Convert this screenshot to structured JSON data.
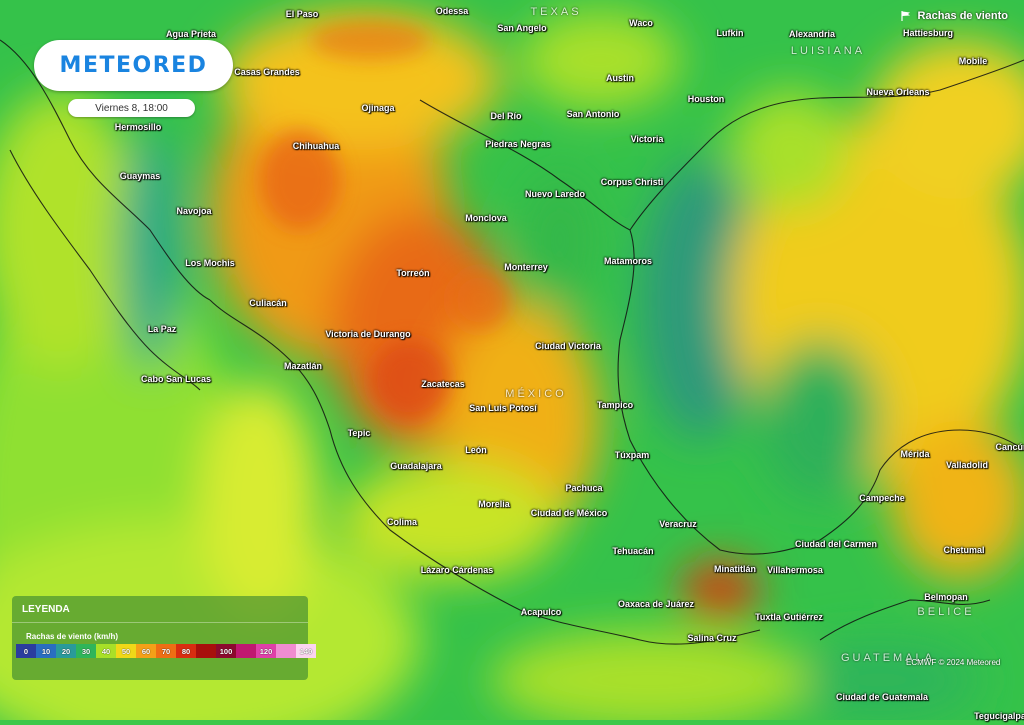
{
  "brand": {
    "logo_text": "METEORED"
  },
  "forecast": {
    "datetime": "Viernes 8, 18:00"
  },
  "layer": {
    "label": "Rachas de viento",
    "icon": "flag-icon"
  },
  "legend": {
    "title": "LEYENDA",
    "units_label": "Rachas de viento (km/h)",
    "scale": [
      {
        "label": "0",
        "color": "#2b3d9e"
      },
      {
        "label": "10",
        "color": "#2a6ec0"
      },
      {
        "label": "20",
        "color": "#2a9a9a"
      },
      {
        "label": "30",
        "color": "#2fb55a"
      },
      {
        "label": "40",
        "color": "#a8e028"
      },
      {
        "label": "50",
        "color": "#f0d818"
      },
      {
        "label": "60",
        "color": "#f4a018"
      },
      {
        "label": "70",
        "color": "#ee6e14"
      },
      {
        "label": "80",
        "color": "#d82d10"
      },
      {
        "label": "",
        "color": "#a8100c"
      },
      {
        "label": "100",
        "color": "#8c0a2e"
      },
      {
        "label": "",
        "color": "#c01870"
      },
      {
        "label": "120",
        "color": "#e040a8"
      },
      {
        "label": "",
        "color": "#f08cd0"
      },
      {
        "label": "140",
        "color": "#fbd4f0"
      }
    ]
  },
  "credit": "ECMWF © 2024 Meteored",
  "regions": [
    "TEXAS",
    "LUISIANA",
    "MÉXICO",
    "GUATEMALA",
    "BELICE"
  ],
  "cities": [
    "El Paso",
    "Odessa",
    "San Angelo",
    "Waco",
    "Lufkin",
    "Alexandria",
    "Hattiesburg",
    "Agua Prieta",
    "Casas Grandes",
    "Mobile",
    "Austin",
    "Nueva Orleans",
    "Ojinaga",
    "Del Río",
    "San Antonio",
    "Houston",
    "Hermosillo",
    "Chihuahua",
    "Piedras Negras",
    "Victoria",
    "Guaymas",
    "Corpus Christi",
    "Nuevo Laredo",
    "Navojoa",
    "Monclova",
    "Los Mochis",
    "Torreón",
    "Monterrey",
    "Matamoros",
    "Culiacán",
    "La Paz",
    "Victoria de Durango",
    "Ciudad Victoria",
    "Mazatlán",
    "Cabo San Lucas",
    "Zacatecas",
    "San Luis Potosí",
    "Tampico",
    "Tepic",
    "León",
    "Túxpam",
    "Mérida",
    "Valladolid",
    "Guadalajara",
    "Pachuca",
    "Campeche",
    "Morelia",
    "Colima",
    "Ciudad de México",
    "Veracruz",
    "Ciudad del Carmen",
    "Tehuacán",
    "Chetumal",
    "Lázaro Cárdenas",
    "Minatitlán",
    "Villahermosa",
    "Belmopan",
    "Acapulco",
    "Oaxaca de Juárez",
    "Tuxtla Gutiérrez",
    "Salina Cruz",
    "Ciudad de Guatemala",
    "Tegucigalpa",
    "Cancún"
  ]
}
